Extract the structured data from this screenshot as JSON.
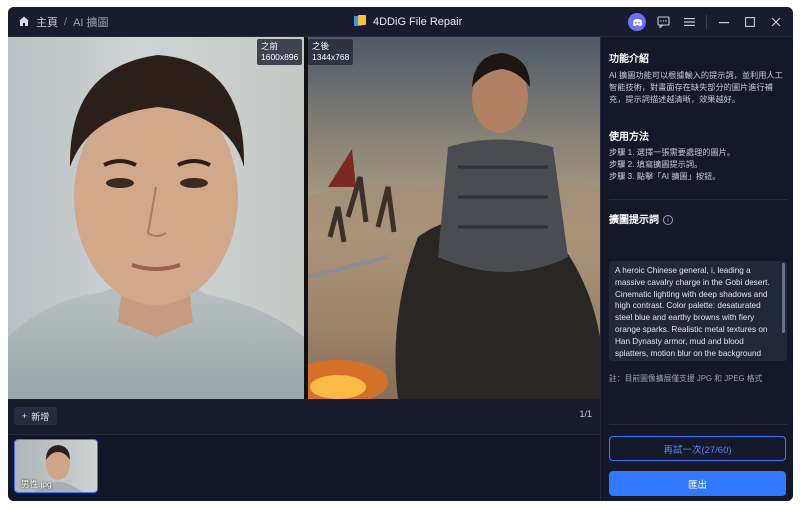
{
  "breadcrumb": {
    "home": "主頁",
    "separator": "/",
    "current": "AI 擴圖"
  },
  "app": {
    "title": "4DDiG File Repair"
  },
  "compare": {
    "before_label": "之前",
    "before_size": "1600x896",
    "after_label": "之後",
    "after_size": "1344x768"
  },
  "toolbar": {
    "add_label": "新增",
    "page": "1/1"
  },
  "thumbnails": [
    {
      "name": "男性.jpg"
    }
  ],
  "panel": {
    "intro_title": "功能介紹",
    "intro_text": "AI 擴圖功能可以根據輸入的提示詞，並利用人工智能技術，對畫面存在缺失部分的圖片進行補充，提示詞描述越清晰，效果越好。",
    "usage_title": "使用方法",
    "steps": [
      "步驟 1. 選擇一張需要處理的圖片。",
      "步驟 2. 填寫擴圖提示詞。",
      "步驟 3. 點擊「AI 擴圖」按鈕。"
    ],
    "prompt_title": "擴圖提示詞",
    "prompt_text": "A heroic Chinese general, i, leading a massive cavalry charge in the Gobi desert. Cinematic lighting with deep shadows and high contrast. Color palette: desaturated steel blue and earthy browns with fiery orange sparks. Realistic metal textures on Han Dynasty armor, mud and blood splatters, motion blur on the background",
    "note": "註：目前圖像擴展僅支援 JPG 和 JPEG 格式",
    "retry_label": "再試一次(27/60)",
    "export_label": "匯出"
  },
  "colors": {
    "accent": "#2f78ff",
    "window_bg": "#121626",
    "panel_bg": "#141829"
  }
}
